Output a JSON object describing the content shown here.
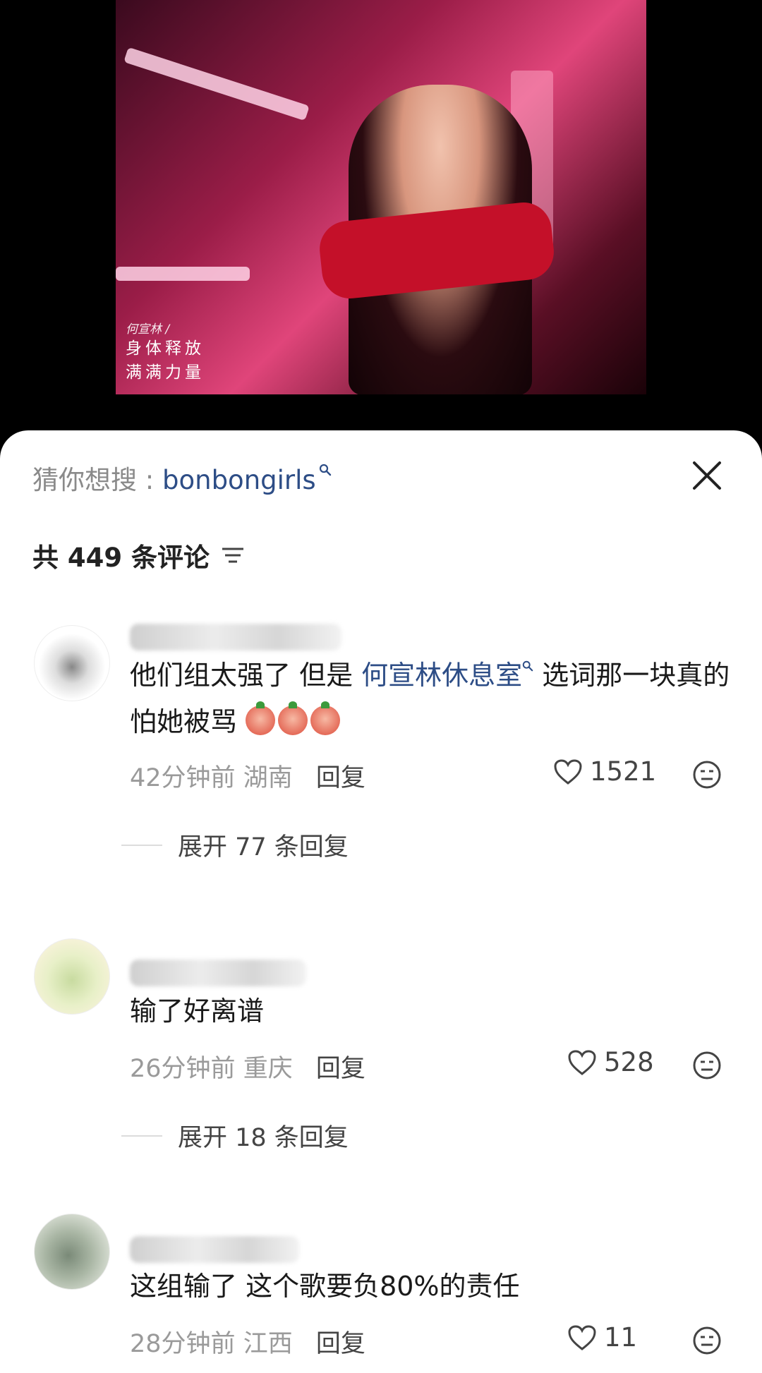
{
  "video": {
    "caption_name": "何宣林 /",
    "caption_line1": "身体释放",
    "caption_line2": "满满力量"
  },
  "sheet": {
    "suggest_prefix": "猜你想搜 : ",
    "suggest_term": "bonbongirls",
    "comment_count_title": "共 449 条评论"
  },
  "comments": [
    {
      "text_before_topic": "他们组太强了 但是 ",
      "topic": "何宣林休息室",
      "text_after_topic": " 选词那一块真的怕她被骂",
      "time": "42分钟前",
      "region": "湖南",
      "reply_label": "回复",
      "likes": "1521",
      "expand_label": "展开 77 条回复"
    },
    {
      "text": "输了好离谱",
      "time": "26分钟前",
      "region": "重庆",
      "reply_label": "回复",
      "likes": "528",
      "expand_label": "展开 18 条回复"
    },
    {
      "text": "这组输了 这个歌要负80%的责任",
      "time": "28分钟前",
      "region": "江西",
      "reply_label": "回复",
      "likes": "11"
    }
  ],
  "colors": {
    "link": "#2d4d86",
    "muted": "#9a9a9a"
  }
}
